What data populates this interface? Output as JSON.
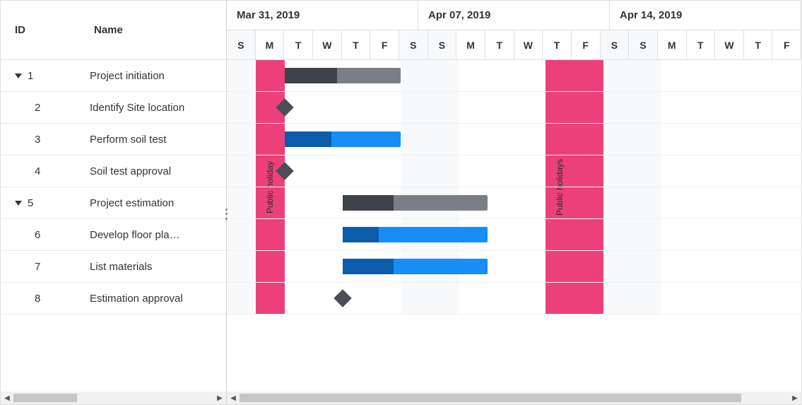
{
  "columns": {
    "id": "ID",
    "name": "Name"
  },
  "tasks": [
    {
      "id": "1",
      "name": "Project initiation",
      "level": 0,
      "hasChildren": true,
      "type": "summary",
      "start": 2,
      "span": 4,
      "progress": 0.45
    },
    {
      "id": "2",
      "name": "Identify Site location",
      "level": 1,
      "type": "milestone",
      "at": 2
    },
    {
      "id": "3",
      "name": "Perform soil test",
      "level": 1,
      "type": "task",
      "start": 2,
      "span": 4,
      "progress": 0.4
    },
    {
      "id": "4",
      "name": "Soil test approval",
      "level": 1,
      "type": "milestone",
      "at": 2
    },
    {
      "id": "5",
      "name": "Project estimation",
      "level": 0,
      "hasChildren": true,
      "type": "summary",
      "start": 4,
      "span": 5,
      "progress": 0.35
    },
    {
      "id": "6",
      "name": "Develop floor pla…",
      "level": 1,
      "type": "task",
      "start": 4,
      "span": 5,
      "progress": 0.25
    },
    {
      "id": "7",
      "name": "List materials",
      "level": 1,
      "type": "task",
      "start": 4,
      "span": 5,
      "progress": 0.35
    },
    {
      "id": "8",
      "name": "Estimation approval",
      "level": 1,
      "type": "milestone",
      "at": 4
    }
  ],
  "timeline": {
    "dayWidth": 41,
    "weeks": [
      {
        "label": "Mar 31, 2019",
        "days": 7
      },
      {
        "label": "Apr 07, 2019",
        "days": 7
      },
      {
        "label": "Apr 14, 2019",
        "days": 7
      }
    ],
    "dayLetters": [
      "S",
      "M",
      "T",
      "W",
      "T",
      "F",
      "S",
      "S",
      "M",
      "T",
      "W",
      "T",
      "F",
      "S",
      "S",
      "M",
      "T",
      "W",
      "T",
      "F"
    ],
    "weekendCols": [
      0,
      6,
      7,
      13,
      14
    ],
    "holidays": [
      {
        "col": 1,
        "label": "Public holiday"
      },
      {
        "col": 11,
        "label": "Public holidays"
      },
      {
        "col": 12,
        "label": ""
      }
    ]
  }
}
